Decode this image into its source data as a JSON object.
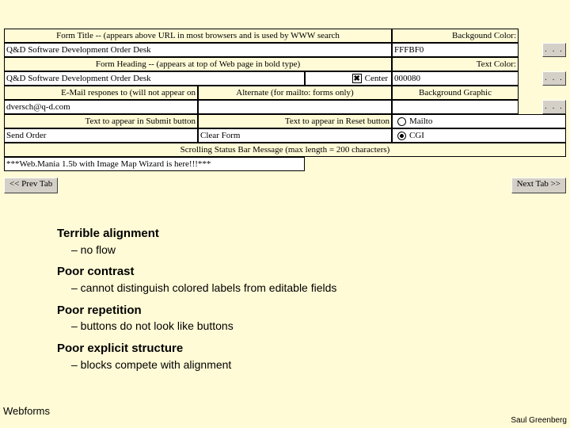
{
  "form": {
    "title_label": "Form Title -- (appears above URL in most browsers and is used by WWW search",
    "title_value": "Q&D Software Development Order Desk",
    "bg_color_label": "Backgound Color:",
    "bg_color_value": "FFFBF0",
    "ellipsis": ". . .",
    "heading_label": "Form Heading -- (appears at top of Web page in bold type)",
    "heading_value": "Q&D Software Development Order Desk",
    "text_color_label": "Text Color:",
    "text_color_value": "000080",
    "center_label": "Center",
    "email_label": "E-Mail respones to (will not appear on",
    "email_value": "dversch@q-d.com",
    "alternate_label": "Alternate (for mailto: forms only)",
    "alternate_value": "",
    "bg_graphic_label": "Background Graphic",
    "bg_graphic_value": "",
    "submit_label": "Text to appear in Submit button",
    "submit_value": "Send Order",
    "reset_label": "Text to appear in Reset button",
    "reset_value": "Clear Form",
    "mailto_label": "Mailto",
    "cgi_label": "CGI",
    "scroll_label": "Scrolling Status Bar Message (max length = 200 characters)",
    "scroll_value": "***Web.Mania 1.5b with Image Map Wizard is here!!!***",
    "prev_tab": "<< Prev Tab",
    "next_tab": "Next Tab >>"
  },
  "critique": {
    "h1": "Terrible alignment",
    "s1": "–  no flow",
    "h2": "Poor contrast",
    "s2": "–  cannot distinguish colored labels from editable fields",
    "h3": "Poor repetition",
    "s3": "–  buttons do not look like buttons",
    "h4": "Poor explicit structure",
    "s4": "–  blocks compete with alignment"
  },
  "footer": {
    "left": "Webforms",
    "right": "Saul Greenberg"
  }
}
